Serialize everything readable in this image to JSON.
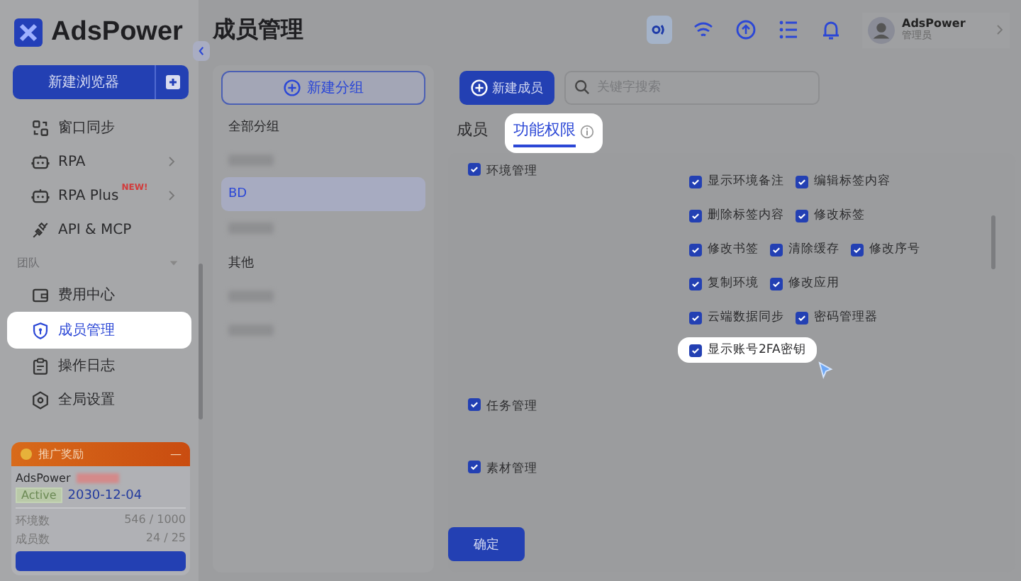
{
  "app": {
    "logo": "AdsPower"
  },
  "page_title": "成员管理",
  "sidebar": {
    "new_browser_button": "新建浏览器",
    "items": [
      {
        "label": "窗口同步",
        "chevron": false,
        "selected": false,
        "highlighted": false
      },
      {
        "label": "RPA",
        "chevron": true,
        "selected": false,
        "highlighted": false
      },
      {
        "label": "RPA Plus",
        "chevron": true,
        "badge": "NEW!",
        "selected": false,
        "highlighted": false
      },
      {
        "label": "API & MCP",
        "chevron": false,
        "selected": false,
        "highlighted": false
      }
    ],
    "section": {
      "label": "团队",
      "expanded": true
    },
    "team_items": [
      {
        "label": "费用中心",
        "chevron": false,
        "selected": false,
        "highlighted": false
      },
      {
        "label": "成员管理",
        "chevron": false,
        "selected": true,
        "highlighted": true
      },
      {
        "label": "操作日志",
        "chevron": false,
        "selected": false,
        "highlighted": false
      },
      {
        "label": "全局设置",
        "chevron": false,
        "selected": false,
        "highlighted": false
      }
    ],
    "promo": {
      "title": "推广奖励",
      "collapse": "—",
      "account": "AdsPower",
      "status": "Active",
      "expiry": "2030-12-04",
      "stats": [
        {
          "label": "环境数",
          "value": "546 / 1000"
        },
        {
          "label": "成员数",
          "value": "24 / 25"
        }
      ]
    }
  },
  "top_bar": {
    "user_name": "AdsPower",
    "user_role": "管理员"
  },
  "groups": {
    "new_group_button": "新建分组",
    "items": [
      {
        "kind": "text",
        "label": "全部分组",
        "selected": false
      },
      {
        "kind": "blurred",
        "selected": false
      },
      {
        "kind": "text",
        "label": "BD",
        "selected": true
      },
      {
        "kind": "blurred",
        "selected": false
      },
      {
        "kind": "text",
        "label": "其他",
        "selected": false
      },
      {
        "kind": "blurred",
        "selected": false
      },
      {
        "kind": "blurred",
        "selected": false
      }
    ]
  },
  "toolbar": {
    "new_member_button": "新建成员",
    "search": {
      "placeholder": "关键字搜索"
    }
  },
  "tabs": [
    {
      "label": "成员",
      "selected": false,
      "highlighted": false,
      "info": false
    },
    {
      "label": "功能权限",
      "selected": true,
      "highlighted": true,
      "info": true
    }
  ],
  "permissions": [
    {
      "label": "环境管理",
      "checked": true,
      "rows": [
        [
          {
            "label": "显示环境备注",
            "checked": true,
            "highlighted": false
          },
          {
            "label": "编辑标签内容",
            "checked": true,
            "highlighted": false
          }
        ],
        [
          {
            "label": "删除标签内容",
            "checked": true,
            "highlighted": false
          },
          {
            "label": "修改标签",
            "checked": true,
            "highlighted": false
          }
        ],
        [
          {
            "label": "修改书签",
            "checked": true,
            "highlighted": false
          },
          {
            "label": "清除缓存",
            "checked": true,
            "highlighted": false
          },
          {
            "label": "修改序号",
            "checked": true,
            "highlighted": false
          }
        ],
        [
          {
            "label": "复制环境",
            "checked": true,
            "highlighted": false
          },
          {
            "label": "修改应用",
            "checked": true,
            "highlighted": false
          }
        ],
        [
          {
            "label": "云端数据同步",
            "checked": true,
            "highlighted": false
          },
          {
            "label": "密码管理器",
            "checked": true,
            "highlighted": false
          }
        ],
        [
          {
            "label": "显示账号2FA密钥",
            "checked": true,
            "highlighted": true
          }
        ]
      ]
    },
    {
      "label": "任务管理",
      "checked": true
    },
    {
      "label": "素材管理",
      "checked": true
    }
  ],
  "confirm_button": "确定"
}
